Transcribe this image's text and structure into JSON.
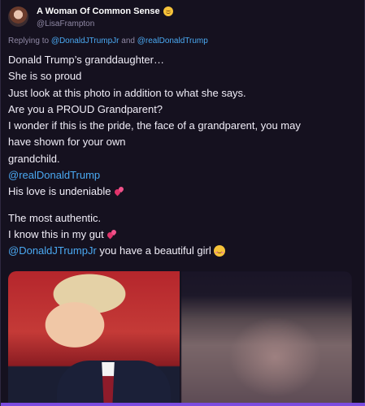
{
  "author": {
    "display_name": "A Woman Of Common Sense",
    "handle": "@LisaFrampton",
    "avatar_icon": "profile-photo",
    "name_emoji_icon": "smiling-face-icon"
  },
  "reply": {
    "prefix": "Replying to ",
    "mention_1": "@DonaldJTrumpJr",
    "joiner": " and ",
    "mention_2": "@realDonaldTrump"
  },
  "body": {
    "line_1": "Donald Trump’s granddaughter…",
    "line_2": "She is so proud",
    "line_3": "Just look at this photo in addition to what she says.",
    "line_4": "Are you a PROUD Grandparent?",
    "line_5": "I wonder if this is the pride, the face of a grandparent, you may",
    "line_6": "have shown for your own",
    "line_7": "grandchild.",
    "mention_line": "@realDonaldTrump",
    "line_8": "His love is undeniable",
    "line_9": "The most authentic.",
    "line_10": "I know this in my gut",
    "mention_last": "@DonaldJTrumpJr",
    "line_11": " you have a beautiful girl"
  },
  "media": {
    "left_photo": "photo-smiling-man",
    "right_photo": "photo-blurred"
  },
  "colors": {
    "background": "#15111f",
    "link": "#4aa9f2",
    "accent_bar": "#7b4ce0"
  }
}
